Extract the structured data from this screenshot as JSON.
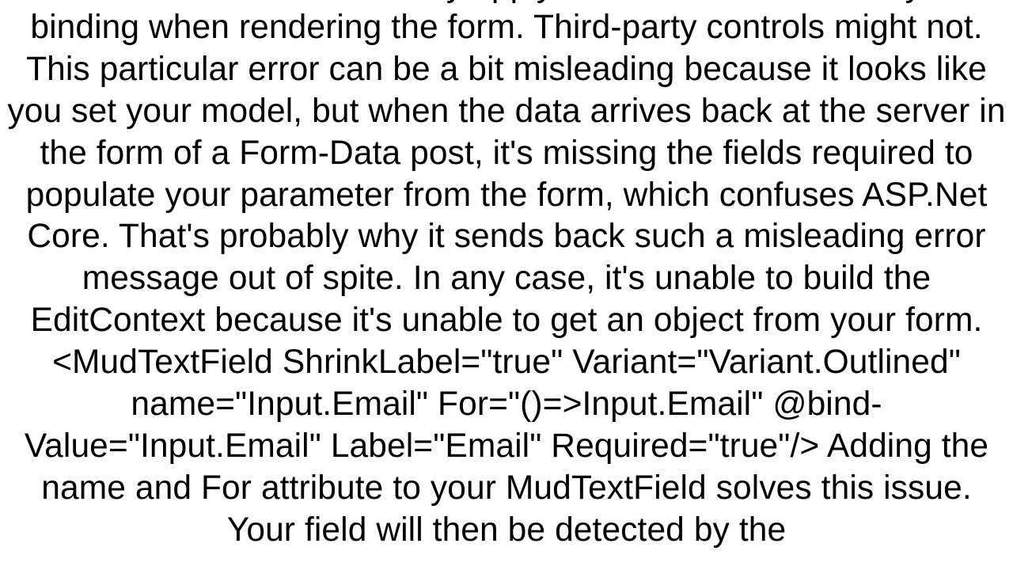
{
  "body": {
    "paragraph1": "from Microsoft automatically apply this attribute based on your binding when rendering the form.  Third-party controls might not. This particular error can be a bit misleading because it looks like you set your model, but when the data arrives back at the server in the form of a Form-Data post, it's missing the fields required to populate your parameter from the form, which confuses ASP.Net Core. That's probably why it sends back such a misleading error message out of spite. In any case, it's unable to build the EditContext because it's unable to get an object from your form.",
    "codeSnippet": "<MudTextField ShrinkLabel=\"true\" Variant=\"Variant.Outlined\" name=\"Input.Email\" For=\"()=>Input.Email\" @bind-Value=\"Input.Email\" Label=\"Email\" Required=\"true\"/>",
    "paragraph2": "Adding the name and For attribute to your MudTextField solves this issue. Your field will then be detected by the"
  }
}
